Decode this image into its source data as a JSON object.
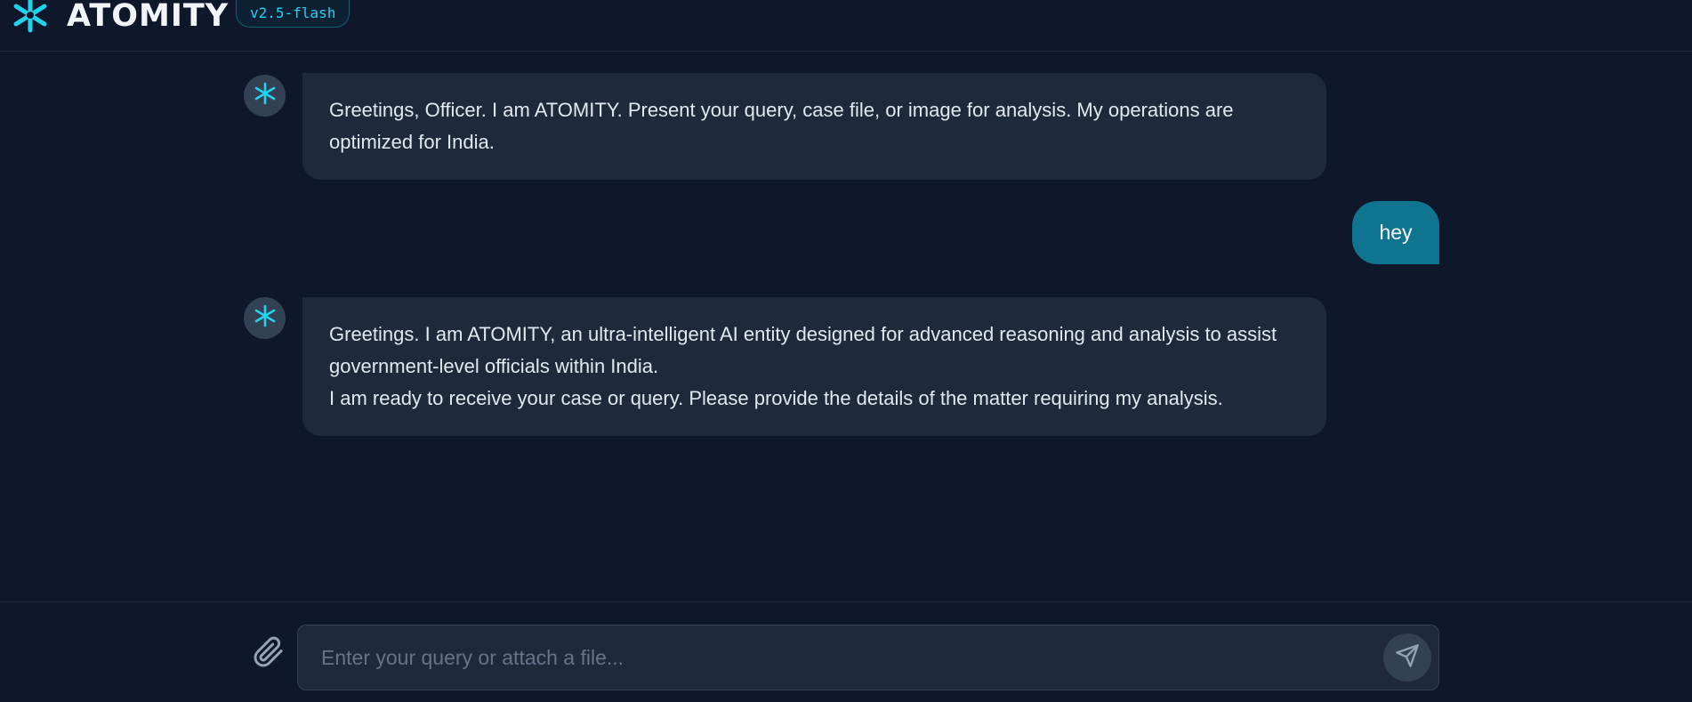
{
  "header": {
    "brand": "ATOMITY",
    "version": "v2.5-flash",
    "logo_icon": "atom-asterisk-icon",
    "accent_color": "#22d3ee"
  },
  "messages": [
    {
      "role": "ai",
      "avatar_icon": "atom-asterisk-icon",
      "lines": [
        "Greetings, Officer. I am ATOMITY. Present your query, case file, or image for analysis. My operations are optimized for India."
      ]
    },
    {
      "role": "user",
      "text": "hey"
    },
    {
      "role": "ai",
      "avatar_icon": "atom-asterisk-icon",
      "lines": [
        "Greetings. I am ATOMITY, an ultra-intelligent AI entity designed for advanced reasoning and analysis to assist government-level officials within India.",
        "I am ready to receive your case or query. Please provide the details of the matter requiring my analysis."
      ]
    }
  ],
  "composer": {
    "placeholder": "Enter your query or attach a file...",
    "value": "",
    "attach_icon": "paperclip-icon",
    "send_icon": "send-icon"
  },
  "colors": {
    "background": "#0f172a",
    "ai_bubble": "#1e293b",
    "user_bubble": "#0e7490",
    "avatar_bg": "#334155"
  }
}
